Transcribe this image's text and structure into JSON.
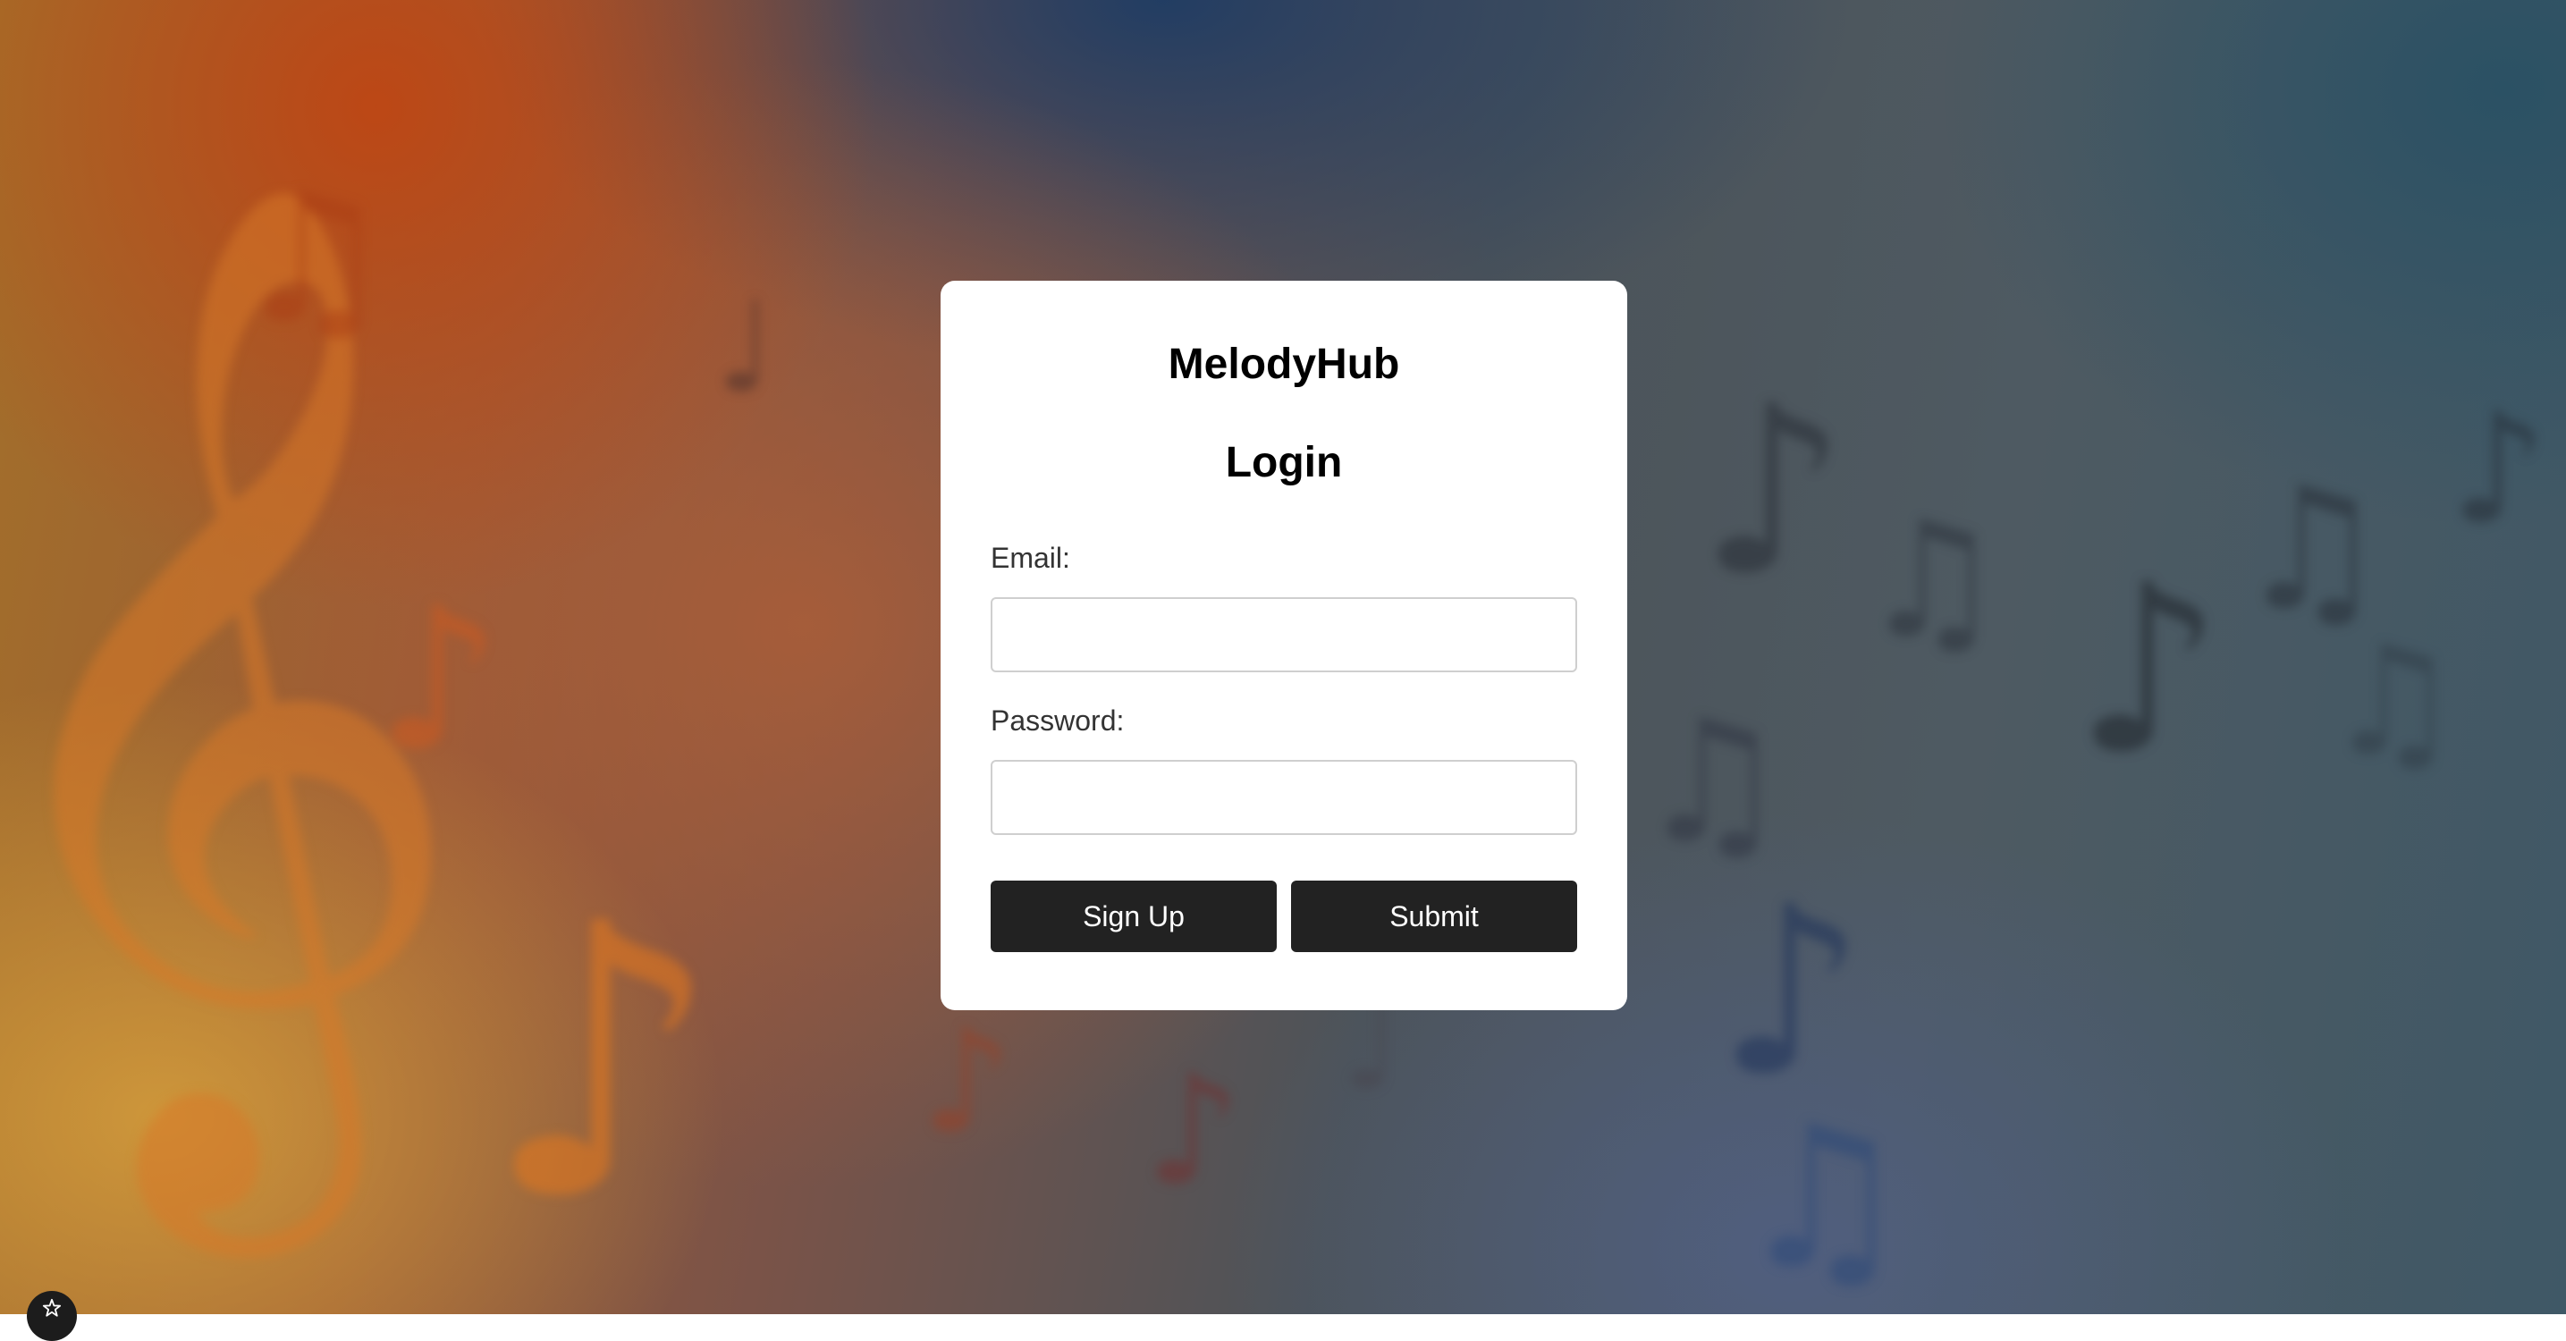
{
  "background": {
    "theme": "blurred music notes",
    "icons": [
      "treble-clef-icon",
      "eighth-note-icon",
      "beamed-notes-icon",
      "quarter-note-icon"
    ],
    "colors": {
      "warm": "#c0501c",
      "gold": "#d6a03c",
      "cool": "#1e3c64",
      "slate": "#4e5a62"
    }
  },
  "card": {
    "app_name": "MelodyHub",
    "heading": "Login",
    "email_label": "Email:",
    "email_value": "",
    "email_placeholder": "",
    "password_label": "Password:",
    "password_value": "",
    "password_placeholder": "",
    "signup_label": "Sign Up",
    "submit_label": "Submit",
    "button_color": "#222222"
  },
  "corner_badge": {
    "icon": "star-icon"
  }
}
